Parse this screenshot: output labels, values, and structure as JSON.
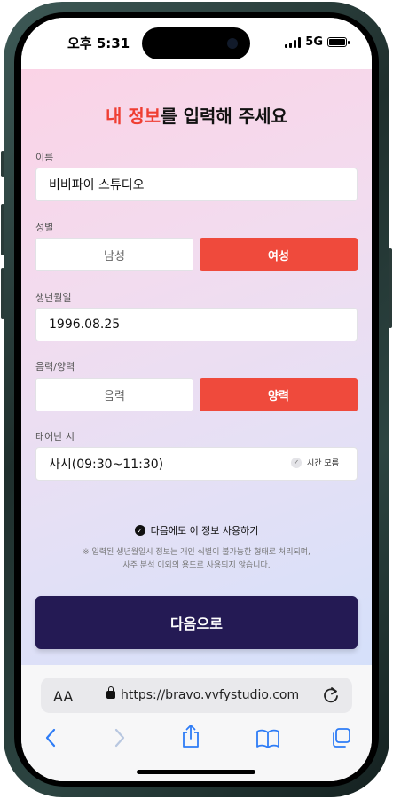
{
  "status_bar": {
    "time": "오후 5:31",
    "network": "5G"
  },
  "page": {
    "title_highlight": "내 정보",
    "title_rest": "를 입력해 주세요",
    "name": {
      "label": "이름",
      "value": "비비파이 스튜디오"
    },
    "gender": {
      "label": "성별",
      "options": [
        "남성",
        "여성"
      ],
      "selected": "여성"
    },
    "birthdate": {
      "label": "생년월일",
      "value": "1996.08.25"
    },
    "calendar": {
      "label": "음력/양력",
      "options": [
        "음력",
        "양력"
      ],
      "selected": "양력"
    },
    "birth_time": {
      "label": "태어난 시",
      "value": "사시(09:30~11:30)",
      "unknown_label": "시간 모름"
    },
    "save_info_label": "다음에도 이 정보 사용하기",
    "notice_line1": "※ 입력된 생년월일시 정보는 개인 식별이 불가능한 형태로 처리되며,",
    "notice_line2": "사주 분석 이외의 용도로 사용되지 않습니다.",
    "next_button": "다음으로"
  },
  "browser": {
    "aa_label": "AA",
    "url": "https://bravo.vvfystudio.com"
  },
  "colors": {
    "accent": "#ef4a3c",
    "title_highlight": "#ef3e33",
    "primary_button": "#241a54",
    "ios_blue": "#2e7cf6"
  }
}
